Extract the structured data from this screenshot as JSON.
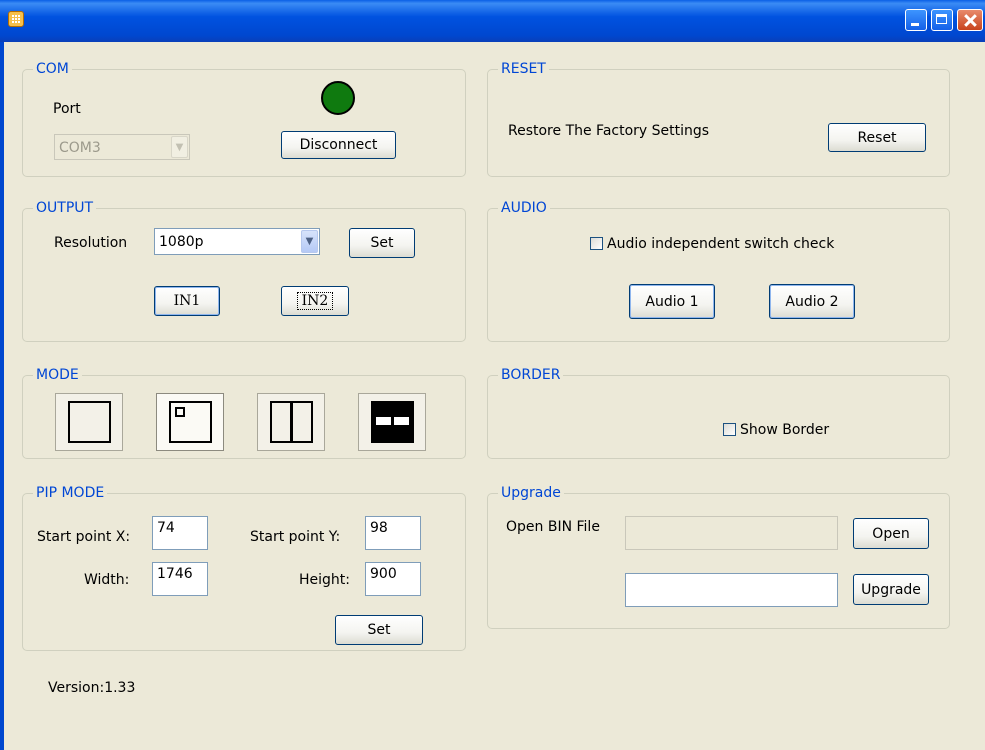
{
  "window": {
    "title": "",
    "accent": "#0046d5"
  },
  "com": {
    "title": "COM",
    "port_label": "Port",
    "port_value": "COM3",
    "connection_color": "#0f7a0f",
    "disconnect_label": "Disconnect"
  },
  "reset": {
    "title": "RESET",
    "description": "Restore The Factory Settings",
    "reset_label": "Reset"
  },
  "output": {
    "title": "OUTPUT",
    "resolution_label": "Resolution",
    "resolution_value": "1080p",
    "set_label": "Set",
    "in1_label": "IN1",
    "in2_label": "IN2"
  },
  "audio": {
    "title": "AUDIO",
    "independent_label": "Audio independent switch check",
    "independent_checked": false,
    "audio1_label": "Audio 1",
    "audio2_label": "Audio 2"
  },
  "mode": {
    "title": "MODE",
    "options": [
      "single-window-icon",
      "pip-icon",
      "split-vertical-icon",
      "split-horizontal-icon"
    ],
    "selected": "pip-icon"
  },
  "border": {
    "title": "BORDER",
    "show_border_label": "Show Border",
    "show_border_checked": false
  },
  "pip": {
    "title": "PIP MODE",
    "start_x_label": "Start point X:",
    "start_x_value": "74",
    "start_y_label": "Start point Y:",
    "start_y_value": "98",
    "width_label": "Width:",
    "width_value": "1746",
    "height_label": "Height:",
    "height_value": "900",
    "set_label": "Set"
  },
  "upgrade": {
    "title": "Upgrade",
    "open_bin_label": "Open BIN File",
    "file_path_value": "",
    "progress_value": "",
    "open_label": "Open",
    "upgrade_label": "Upgrade"
  },
  "version": "Version:1.33"
}
